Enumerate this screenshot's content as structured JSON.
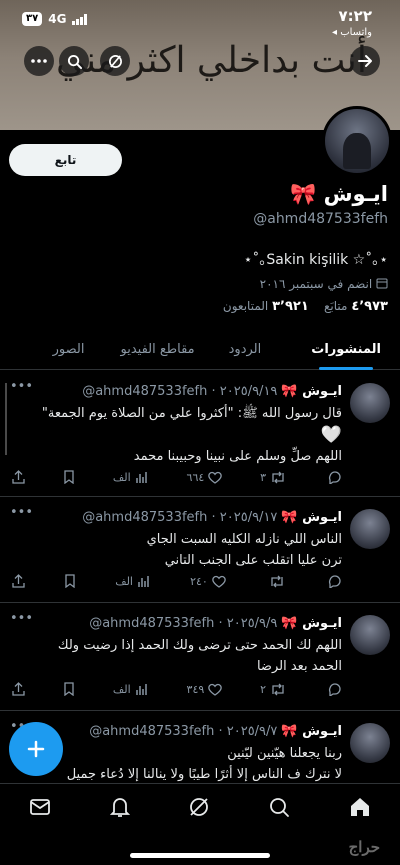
{
  "status_bar": {
    "time": "٧:٢٢",
    "back_label": "◂ واتساب",
    "network": "4G",
    "battery": "٣٧"
  },
  "banner": {
    "text": "أنت بداخلي اكثر مني"
  },
  "header": {
    "follow_label": "تابع"
  },
  "profile": {
    "name": "ايـوش 🎀",
    "handle": "@ahmd487533fefh",
    "bio": "⋆˚｡Sakin kişilik ☆˚｡⋆",
    "joined": "انضم في سبتمبر ٢٠١٦",
    "following_count": "٤٬٩٧٣",
    "following_label": "متابَع",
    "followers_count": "٣٬٩٢١",
    "followers_label": "المتابعون"
  },
  "tabs": [
    "المنشورات",
    "الردود",
    "مقاطع الفيديو",
    "الصور"
  ],
  "tweets": [
    {
      "name": "ايـوش 🎀",
      "meta": "@ahmd487533fefh · ٢٠٢٥/٩/١٩",
      "lines": [
        "قال رسول الله ﷺ: \"أكثروا علي من الصلاة يوم الجمعة\"",
        "🤍",
        "اللهم صلِّ وسلم على نبينا وحبيبنا محمد"
      ],
      "replies": "",
      "retweets": "٣",
      "likes": "٦٦٤",
      "views": "الف"
    },
    {
      "name": "ايـوش 🎀",
      "meta": "@ahmd487533fefh · ٢٠٢٥/٩/١٧",
      "lines": [
        "الناس اللي نازله الكليه السبت الجاي",
        "ترن عليا اتقلب على الجنب التاني"
      ],
      "replies": "",
      "retweets": "",
      "likes": "٢٤٠",
      "views": "الف"
    },
    {
      "name": "ايـوش 🎀",
      "meta": "@ahmd487533fefh · ٢٠٢٥/٩/٩",
      "lines": [
        "اللهم لك الحمد حتى ترضى ولك الحمد إذا رضيت ولك",
        "الحمد بعد الرضا"
      ],
      "replies": "",
      "retweets": "٢",
      "likes": "٣٤٩",
      "views": "الف"
    },
    {
      "name": "ايـوش 🎀",
      "meta": "@ahmd487533fefh · ٢٠٢٥/٩/٧",
      "lines": [
        "ربنا يجعلنا هيّنين ليّنين",
        "لا نترك ف الناس إلا أثرًا طيبًا ولا ينالنا إلا دُعاء جميل"
      ],
      "replies": "",
      "retweets": "",
      "likes": "",
      "views": ""
    }
  ],
  "watermark": "حراج",
  "icons": [
    "back-arrow-icon",
    "search-icon",
    "grok-icon",
    "more-icon",
    "home-icon",
    "search-icon",
    "grok-icon",
    "bell-icon",
    "mail-icon",
    "plus-icon"
  ],
  "colors": {
    "accent": "#1d9bf0",
    "background": "#000000",
    "muted": "#8b98a5"
  }
}
